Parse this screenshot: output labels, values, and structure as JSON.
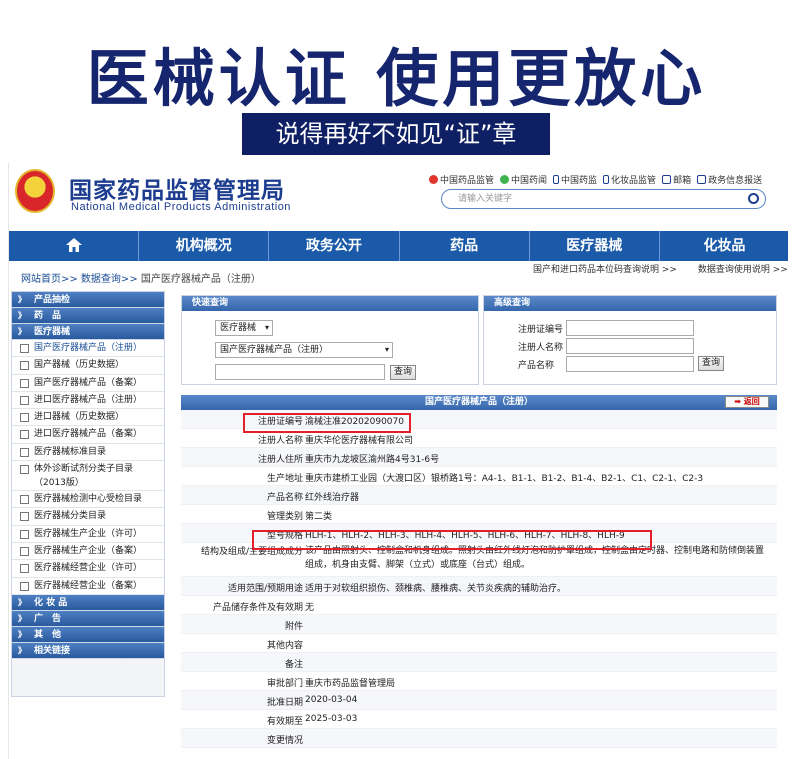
{
  "banner": {
    "title": "医械认证 使用更放心",
    "subtitle": "说得再好不如见“证”章"
  },
  "site": {
    "name_cn": "国家药品监督管理局",
    "name_en": "National Medical Products Administration",
    "top_links": [
      "中国药品监管",
      "中国药闻",
      "中国药监",
      "化妆品监管",
      "邮箱",
      "政务信息报送"
    ],
    "search_placeholder": "请输入关键字"
  },
  "nav": [
    "机构概况",
    "政务公开",
    "药品",
    "医疗器械",
    "化妆品"
  ],
  "breadcrumb": {
    "part1": "网站首页>> 数据查询>>",
    "part2": "国产医疗器械产品（注册）"
  },
  "right_links": [
    "国产和进口药品本位码查询说明 >>",
    "数据查询使用说明 >>"
  ],
  "sidebar": {
    "sections": [
      {
        "head": "产品抽检",
        "items": []
      },
      {
        "head": "药　品",
        "items": []
      },
      {
        "head": "医疗器械",
        "items": [
          "国产医疗器械产品（注册）",
          "国产器械（历史数据）",
          "国产医疗器械产品（备案）",
          "进口医疗器械产品（注册）",
          "进口器械（历史数据）",
          "进口医疗器械产品（备案）",
          "医疗器械标准目录",
          "体外诊断试剂分类子目录（2013版）",
          "医疗器械检测中心受检目录",
          "医疗器械分类目录",
          "医疗器械生产企业（许可）",
          "医疗器械生产企业（备案）",
          "医疗器械经营企业（许可）",
          "医疗器械经营企业（备案）"
        ]
      },
      {
        "head": "化 妆 品",
        "items": []
      },
      {
        "head": "广　告",
        "items": []
      },
      {
        "head": "其　他",
        "items": []
      },
      {
        "head": "相关链接",
        "items": []
      }
    ]
  },
  "quick_search": {
    "title": "快速查询",
    "select1": "医疗器械",
    "select2": "国产医疗器械产品（注册）",
    "button": "查询"
  },
  "advanced_search": {
    "title": "高级查询",
    "field1": "注册证编号",
    "field2": "注册人名称",
    "field3": "产品名称",
    "button": "查询"
  },
  "detail": {
    "title": "国产医疗器械产品（注册）",
    "back": "返回",
    "rows": [
      {
        "k": "注册证编号",
        "v": "渝械注准20202090070"
      },
      {
        "k": "注册人名称",
        "v": "重庆华伦医疗器械有限公司"
      },
      {
        "k": "注册人住所",
        "v": "重庆市九龙坡区渝州路4号31-6号"
      },
      {
        "k": "生产地址",
        "v": "重庆市建桥工业园（大渡口区）银桥路1号：A4-1、B1-1、B1-2、B1-4、B2-1、C1、C2-1、C2-3"
      },
      {
        "k": "产品名称",
        "v": "红外线治疗器"
      },
      {
        "k": "管理类别",
        "v": "第二类"
      },
      {
        "k": "型号规格",
        "v": "HLH-1、HLH-2、HLH-3、HLH-4、HLH-5、HLH-6、HLH-7、HLH-8、HLH-9"
      },
      {
        "k": "结构及组成/主要组成成分",
        "v": "该产品由照射头、控制盒和机身组成。照射头由红外线灯泡和防护罩组成，控制盒由定时器、控制电路和防倾倒装置组成，机身由支臂、脚架（立式）或底座（台式）组成。",
        "multi": true
      },
      {
        "k": "适用范围/预期用途",
        "v": "适用于对软组织损伤、颈椎病、腰椎病、关节炎疾病的辅助治疗。"
      },
      {
        "k": "产品储存条件及有效期",
        "v": "无"
      },
      {
        "k": "附件",
        "v": ""
      },
      {
        "k": "其他内容",
        "v": ""
      },
      {
        "k": "备注",
        "v": ""
      },
      {
        "k": "审批部门",
        "v": "重庆市药品监督管理局"
      },
      {
        "k": "批准日期",
        "v": "2020-03-04"
      },
      {
        "k": "有效期至",
        "v": "2025-03-03"
      },
      {
        "k": "变更情况",
        "v": ""
      }
    ]
  },
  "colors": {
    "banner_title": "#15256e",
    "nav_bg": "#1a5aa8",
    "highlight": "#e3202a"
  }
}
